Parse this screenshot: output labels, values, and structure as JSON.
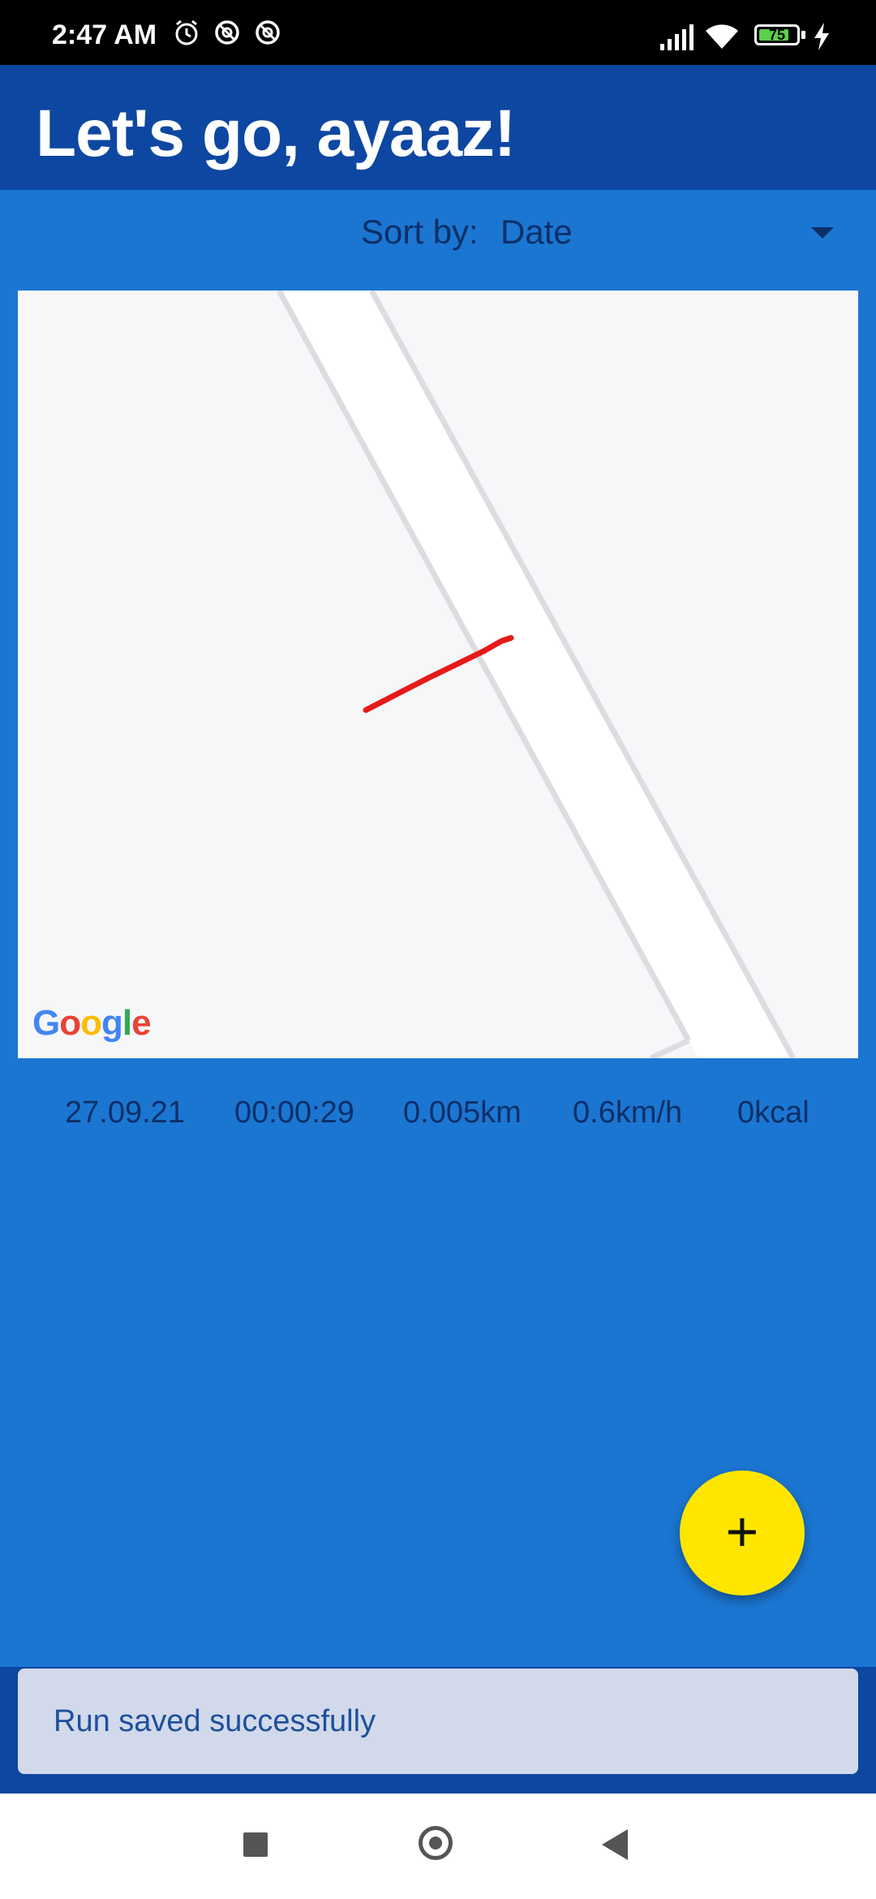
{
  "status_bar": {
    "time": "2:47 AM",
    "battery_level": "75",
    "icons": [
      "alarm-icon",
      "do-not-disturb-icon",
      "do-not-disturb-icon",
      "signal-icon",
      "wifi-icon",
      "battery-icon",
      "charging-icon"
    ]
  },
  "app_bar": {
    "title": "Let's go, ayaaz!"
  },
  "sort": {
    "label": "Sort by:",
    "value": "Date"
  },
  "map": {
    "attribution": "Google",
    "route_color": "#e61a1a"
  },
  "run": {
    "date": "27.09.21",
    "duration": "00:00:29",
    "distance": "0.005km",
    "speed": "0.6km/h",
    "calories": "0kcal"
  },
  "fab": {
    "icon": "plus-icon",
    "color": "#ffe600"
  },
  "snackbar": {
    "message": "Run saved successfully"
  },
  "nav": {
    "icons": [
      "recents-icon",
      "home-icon",
      "back-icon"
    ]
  }
}
